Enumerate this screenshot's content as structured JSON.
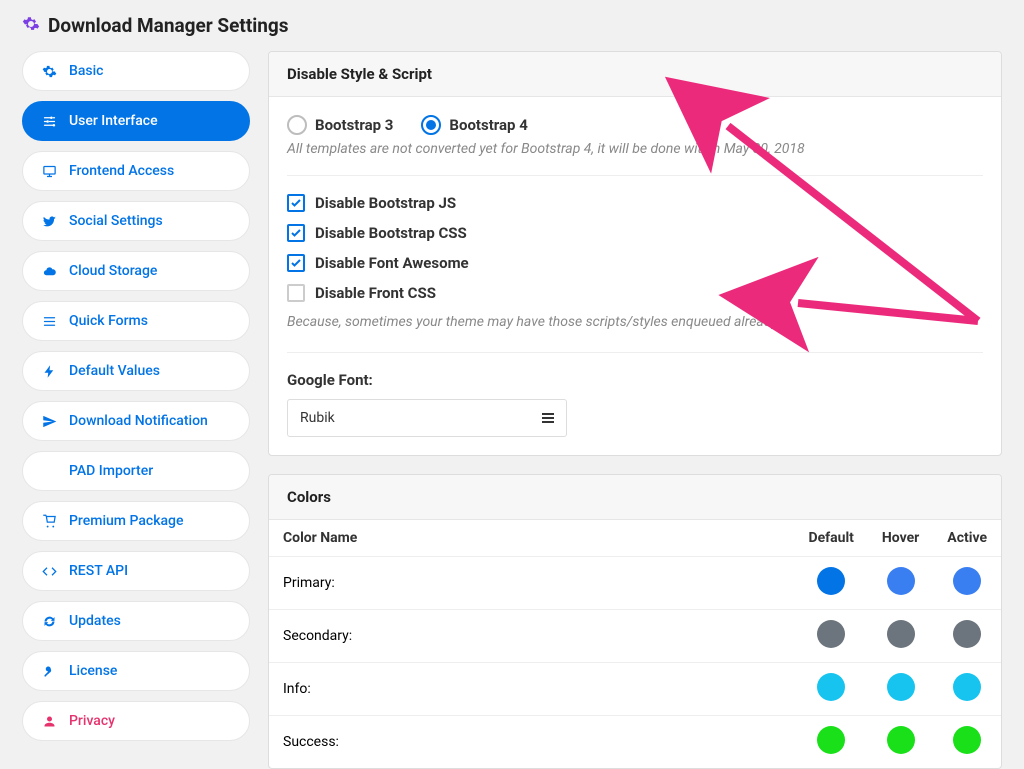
{
  "page": {
    "title": "Download Manager Settings"
  },
  "sidebar": {
    "items": [
      {
        "label": "Basic",
        "icon": "gear",
        "active": false
      },
      {
        "label": "User Interface",
        "icon": "sliders",
        "active": true
      },
      {
        "label": "Frontend Access",
        "icon": "monitor",
        "active": false
      },
      {
        "label": "Social Settings",
        "icon": "bird",
        "active": false
      },
      {
        "label": "Cloud Storage",
        "icon": "cloud",
        "active": false
      },
      {
        "label": "Quick Forms",
        "icon": "menu",
        "active": false
      },
      {
        "label": "Default Values",
        "icon": "bolt",
        "active": false
      },
      {
        "label": "Download Notification",
        "icon": "send",
        "active": false
      },
      {
        "label": "PAD Importer",
        "icon": "none",
        "active": false
      },
      {
        "label": "Premium Package",
        "icon": "cart",
        "active": false
      },
      {
        "label": "REST API",
        "icon": "code",
        "active": false
      },
      {
        "label": "Updates",
        "icon": "refresh",
        "active": false
      },
      {
        "label": "License",
        "icon": "key",
        "active": false
      },
      {
        "label": "Privacy",
        "icon": "user",
        "active": false,
        "special": "privacy"
      }
    ]
  },
  "disable_panel": {
    "heading": "Disable Style & Script",
    "radios": [
      {
        "label": "Bootstrap 3",
        "selected": false
      },
      {
        "label": "Bootstrap 4",
        "selected": true
      }
    ],
    "radio_note": "All templates are not converted yet for Bootstrap 4, it will be done within May 30, 2018",
    "checks": [
      {
        "label": "Disable Bootstrap JS",
        "checked": true
      },
      {
        "label": "Disable Bootstrap CSS",
        "checked": true
      },
      {
        "label": "Disable Font Awesome",
        "checked": true
      },
      {
        "label": "Disable Front CSS",
        "checked": false
      }
    ],
    "check_note": "Because, sometimes your theme may have those scripts/styles enqueued already",
    "font_label": "Google Font:",
    "font_value": "Rubik"
  },
  "colors_panel": {
    "heading": "Colors",
    "columns": [
      "Color Name",
      "Default",
      "Hover",
      "Active"
    ],
    "rows": [
      {
        "name": "Primary:",
        "default": "#0274e6",
        "hover": "#3a7ff2",
        "active": "#3a7ff2"
      },
      {
        "name": "Secondary:",
        "default": "#6c757d",
        "hover": "#6c757d",
        "active": "#6c757d"
      },
      {
        "name": "Info:",
        "default": "#17c4f0",
        "hover": "#17c4f0",
        "active": "#17c4f0"
      },
      {
        "name": "Success:",
        "default": "#19e019",
        "hover": "#19e019",
        "active": "#19e019"
      }
    ]
  },
  "icons": {
    "gear": "⚙",
    "sliders": "🎚",
    "monitor": "🖥",
    "bird": "🐦",
    "cloud": "☁",
    "menu": "≡",
    "bolt": "⚡",
    "send": "✈",
    "cart": "🛒",
    "code": "</>",
    "refresh": "↻",
    "key": "🔑",
    "user": "👤",
    "none": ""
  }
}
